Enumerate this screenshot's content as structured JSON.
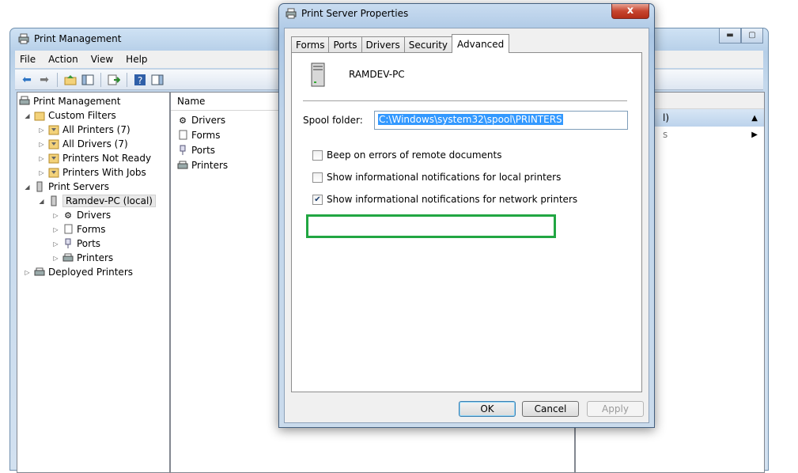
{
  "main_window": {
    "title": "Print Management",
    "menu": [
      "File",
      "Action",
      "View",
      "Help"
    ],
    "tree": {
      "root": "Print Management",
      "custom_filters": "Custom Filters",
      "filters": [
        "All Printers (7)",
        "All Drivers (7)",
        "Printers Not Ready",
        "Printers With Jobs"
      ],
      "print_servers": "Print Servers",
      "server": "Ramdev-PC (local)",
      "server_children": [
        "Drivers",
        "Forms",
        "Ports",
        "Printers"
      ],
      "deployed": "Deployed Printers"
    },
    "list": {
      "column_name": "Name",
      "items": [
        "Drivers",
        "Forms",
        "Ports",
        "Printers"
      ]
    },
    "actions_partial": {
      "header_fragment": "l)",
      "row_fragment": "s"
    }
  },
  "dialog": {
    "title": "Print Server Properties",
    "close_glyph": "x",
    "tabs": [
      "Forms",
      "Ports",
      "Drivers",
      "Security",
      "Advanced"
    ],
    "active_tab": "Advanced",
    "server_name": "RAMDEV-PC",
    "spool_label": "Spool folder:",
    "spool_value": "C:\\Windows\\system32\\spool\\PRINTERS",
    "checkboxes": [
      {
        "label": "Beep on errors of remote documents",
        "checked": false
      },
      {
        "label": "Show informational notifications for local printers",
        "checked": false
      },
      {
        "label": "Show informational notifications for network printers",
        "checked": true
      }
    ],
    "buttons": {
      "ok": "OK",
      "cancel": "Cancel",
      "apply": "Apply"
    }
  },
  "colors": {
    "highlight_border": "#21a642",
    "selection": "#3399ff"
  }
}
